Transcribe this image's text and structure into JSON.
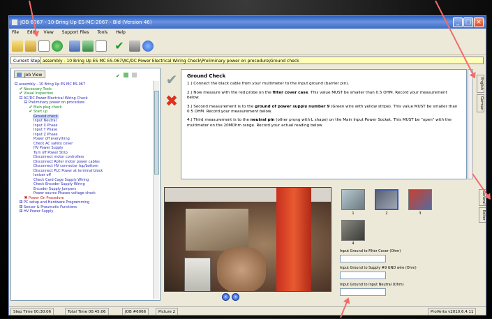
{
  "window": {
    "title": "JOB 6067 - 10-Bring Up ES-MC-2067 - Bld (Version 46)"
  },
  "menu": [
    "File",
    "Edit",
    "View",
    "Support Files",
    "Tools",
    "Help"
  ],
  "step": {
    "label": "Current Step",
    "path": "assembly - 10 Bring Up ES MC ES-067\\AC/DC Power Electrical Wiring Check\\Preliminary power on procedure\\Ground check"
  },
  "job_tab": "Job View",
  "tree": [
    {
      "text": "assembly - 10 Bring Up ES-MC ES-067",
      "icon": "minus",
      "color": "blue",
      "indent": 0
    },
    {
      "text": "Necessary Tools",
      "icon": "check",
      "color": "green",
      "indent": 1
    },
    {
      "text": "Visual Inspection",
      "icon": "check",
      "color": "green",
      "indent": 1
    },
    {
      "text": "AC/DC Power Electrical Wiring Check",
      "icon": "minus",
      "color": "blue",
      "indent": 1
    },
    {
      "text": "Preliminary power on procedure",
      "icon": "minus",
      "color": "blue",
      "indent": 2
    },
    {
      "text": "Main plug check",
      "icon": "check",
      "color": "green",
      "indent": 3
    },
    {
      "text": "Start up",
      "icon": "check",
      "color": "green",
      "indent": 3
    },
    {
      "text": "Ground check",
      "icon": "",
      "color": "blue",
      "indent": 3,
      "selected": true
    },
    {
      "text": "Input Neutral",
      "icon": "",
      "color": "blue",
      "indent": 3
    },
    {
      "text": "Input X Phase",
      "icon": "",
      "color": "blue",
      "indent": 3
    },
    {
      "text": "Input Y Phase",
      "icon": "",
      "color": "blue",
      "indent": 3
    },
    {
      "text": "Input Z Phase",
      "icon": "",
      "color": "blue",
      "indent": 3
    },
    {
      "text": "Power off everything",
      "icon": "",
      "color": "blue",
      "indent": 3
    },
    {
      "text": "Check AC safety cover",
      "icon": "",
      "color": "blue",
      "indent": 3
    },
    {
      "text": "HV Power Supply",
      "icon": "",
      "color": "blue",
      "indent": 3
    },
    {
      "text": "Turn off Power Strip",
      "icon": "",
      "color": "blue",
      "indent": 3
    },
    {
      "text": "Disconnect motor controllers",
      "icon": "",
      "color": "blue",
      "indent": 3
    },
    {
      "text": "Disconnect Roller motor power cables",
      "icon": "",
      "color": "blue",
      "indent": 3
    },
    {
      "text": "Disconnect HV connector top/bottom",
      "icon": "",
      "color": "blue",
      "indent": 3
    },
    {
      "text": "Disconnect PLC Power at terminal block",
      "icon": "",
      "color": "blue",
      "indent": 3
    },
    {
      "text": "Ionizer off",
      "icon": "",
      "color": "blue",
      "indent": 3
    },
    {
      "text": "Check Card Cage Supply Wiring",
      "icon": "",
      "color": "blue",
      "indent": 3
    },
    {
      "text": "Check Encoder Supply Wiring",
      "icon": "",
      "color": "blue",
      "indent": 3
    },
    {
      "text": "Encoder Supply Jumpers",
      "icon": "",
      "color": "blue",
      "indent": 3
    },
    {
      "text": "Power source Phases voltage check",
      "icon": "",
      "color": "blue",
      "indent": 3
    },
    {
      "text": "Power On Procedure",
      "icon": "x",
      "color": "red",
      "indent": 2
    },
    {
      "text": "PC setup and Hardware Programming",
      "icon": "plus",
      "color": "blue",
      "indent": 1
    },
    {
      "text": "Sensor & Pneumatic Functions",
      "icon": "plus",
      "color": "blue",
      "indent": 1
    },
    {
      "text": "HV Power Supply",
      "icon": "plus",
      "color": "blue",
      "indent": 1
    }
  ],
  "instructions": {
    "title": "Ground Check",
    "p1": "1.) Connect the black cable from your multimeter to the input ground (barrier pin).",
    "p2a": "2.) Now measure with the red probe on the ",
    "p2b": "filter cover case",
    "p2c": ". This value MUST be smaller than 0.5 OHM. Record your measurement below.",
    "p3a": "3.) Second measurement is to the ",
    "p3b": "ground of power supply number 9",
    "p3c": " (Green wire with yellow stripe). This value MUST be smaller than 0.5 OHM. Record your measurement below.",
    "p4a": "4.) Third measurement is to the ",
    "p4b": "neutral pin",
    "p4c": " (other prong with L shape) on the Main Input Power Socket. This MUST be \"open\" with the multimeter on the 20MOhm range. Record your actual reading below."
  },
  "side_tabs_top": [
    "English",
    "German"
  ],
  "side_tabs_bottom": [
    "General",
    "Editor"
  ],
  "thumbnails": [
    "1",
    "2",
    "3",
    "4"
  ],
  "fields": [
    {
      "label": "Input Ground to Filter Cover (Ohm)",
      "value": ""
    },
    {
      "label": "Input Ground to Supply #9 GND wire (Ohm)",
      "value": ""
    },
    {
      "label": "Input Ground to Input Neutral (Ohm)",
      "value": ""
    }
  ],
  "status": {
    "step_time": "Step Time 00:30:06",
    "total_time": "Total Time 00:45:06",
    "job": "JOB #6066",
    "picture": "Picture 2",
    "version": "ProVerta v2010.6.4.11"
  },
  "colors": {
    "accent_arrow": "#f26c6c",
    "step_field": "#ffffb8",
    "title_bar": "#2b5fbf"
  }
}
